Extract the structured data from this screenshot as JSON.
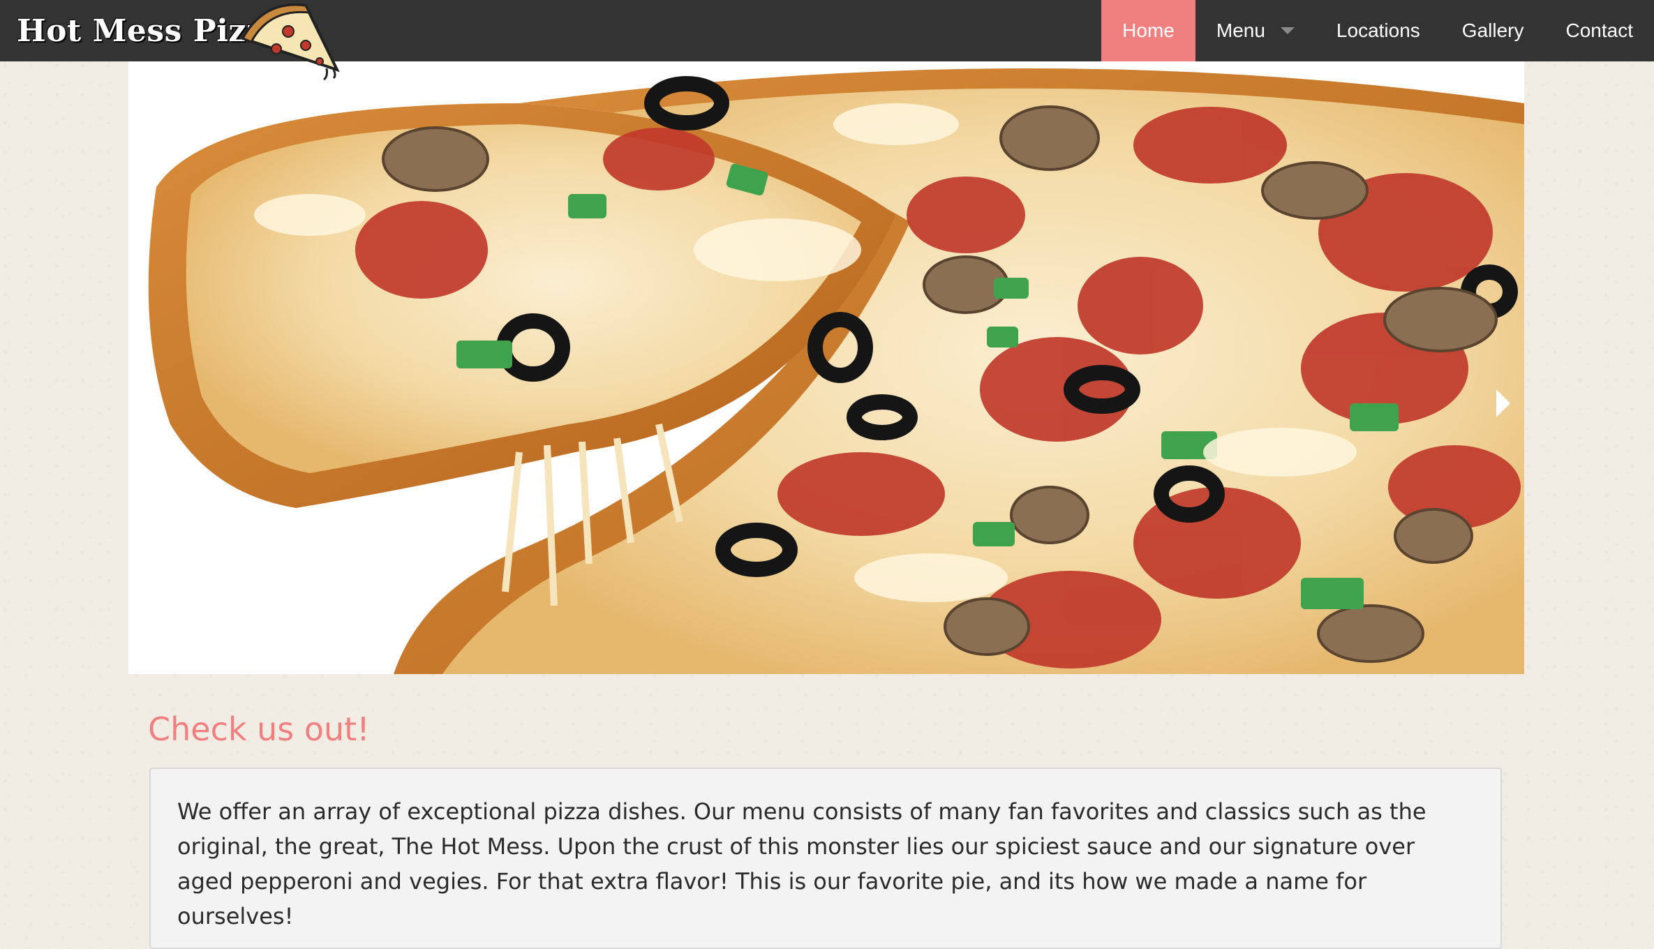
{
  "brand": {
    "name": "Hot Mess Pizza",
    "logo_icon": "pizza-slice-icon"
  },
  "nav": {
    "items": [
      {
        "label": "Home",
        "active": true
      },
      {
        "label": "Menu",
        "has_dropdown": true
      },
      {
        "label": "Locations"
      },
      {
        "label": "Gallery"
      },
      {
        "label": "Contact"
      }
    ]
  },
  "carousel": {
    "image": "pizza-photo",
    "prev_icon": "arrow-left-icon",
    "next_icon": "arrow-right-icon"
  },
  "section": {
    "title": "Check us out!",
    "body": "We offer an array of exceptional pizza dishes. Our menu consists of many fan favorites and classics such as the original, the great, The Hot Mess. Upon the crust of this monster lies our spiciest sauce and our signature over aged pepperoni and vegies. For that extra flavor! This is our favorite pie, and its how we made a name for ourselves!"
  },
  "colors": {
    "topbar": "#333333",
    "accent": "#f08080",
    "page_bg": "#f1ede4",
    "card_bg": "#f3f3f3"
  }
}
